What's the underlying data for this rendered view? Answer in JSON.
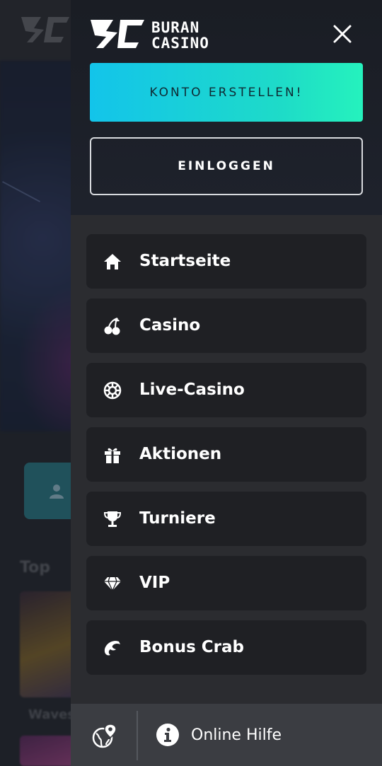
{
  "background": {
    "section_title": "Top",
    "game_label": "Waves"
  },
  "drawer": {
    "brand": {
      "line1": "BURAN",
      "line2": "CASINO"
    },
    "close_icon": "close-icon",
    "register_label": "KONTO ERSTELLEN!",
    "login_label": "EINLOGGEN",
    "menu": [
      {
        "label": "Startseite",
        "icon": "home-icon"
      },
      {
        "label": "Casino",
        "icon": "cherries-icon"
      },
      {
        "label": "Live-Casino",
        "icon": "poker-chip-icon"
      },
      {
        "label": "Aktionen",
        "icon": "gift-icon"
      },
      {
        "label": "Turniere",
        "icon": "trophy-icon"
      },
      {
        "label": "VIP",
        "icon": "diamond-icon"
      },
      {
        "label": "Bonus Crab",
        "icon": "crab-claw-icon"
      }
    ],
    "footer": {
      "language_icon": "globe-pin-icon",
      "help_label": "Online Hilfe",
      "help_icon": "info-icon"
    }
  },
  "colors": {
    "register_gradient_start": "#13c4ea",
    "register_gradient_end": "#25f2bd",
    "drawer_bg": "#2b2c30",
    "menu_item_bg": "#1f2024",
    "footer_bg": "#3b3d42"
  }
}
